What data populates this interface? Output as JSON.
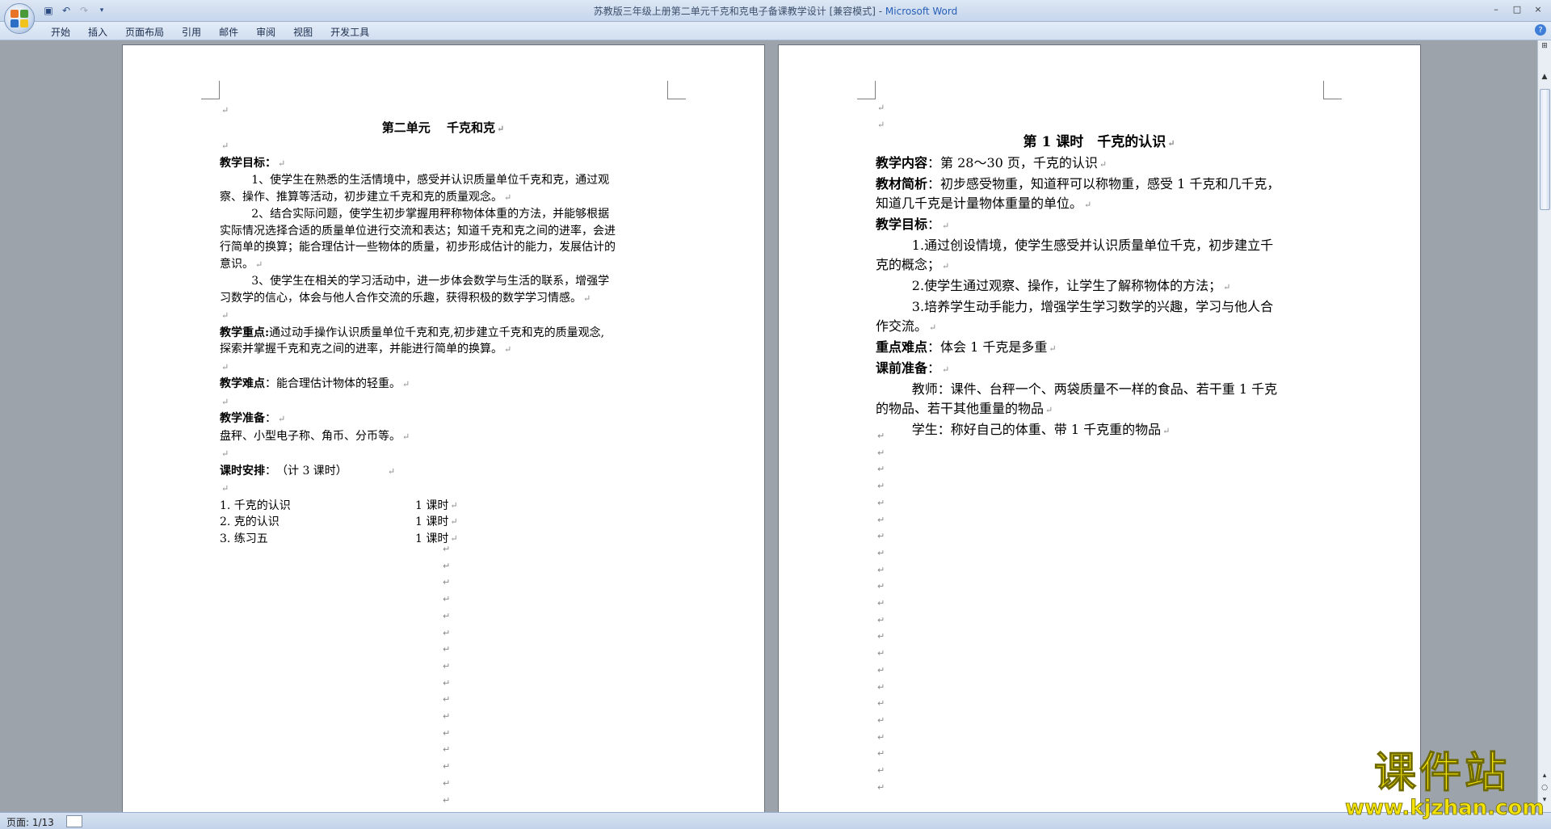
{
  "window": {
    "title_doc": "苏教版三年级上册第二单元千克和克电子备课教学设计 [兼容模式] - ",
    "title_app": "Microsoft Word",
    "min": "–",
    "max": "□",
    "close": "×"
  },
  "ribbon": {
    "tabs": [
      "开始",
      "插入",
      "页面布局",
      "引用",
      "邮件",
      "审阅",
      "视图",
      "开发工具"
    ],
    "help": "?"
  },
  "page1": {
    "title": "第二单元　 千克和克",
    "goals_heading": "教学目标：",
    "goal1_a": "1、使学生在熟悉的生活情境中，感受并认识质量单位千克和克，通过观",
    "goal1_b": "察、操作、推算等活动，初步建立千克和克的质量观念。",
    "goal2_a": "2、结合实际问题，使学生初步掌握用秤称物体体重的方法，并能够根据",
    "goal2_b": "实际情况选择合适的质量单位进行交流和表达；知道千克和克之间的进率，会进",
    "goal2_c": "行简单的换算；能合理估计一些物体的质量，初步形成估计的能力，发展估计的",
    "goal2_d": "意识。",
    "goal3_a": "3、使学生在相关的学习活动中，进一步体会数学与生活的联系，增强学",
    "goal3_b": "习数学的信心，体会与他人合作交流的乐趣，获得积极的数学学习情感。",
    "key_label": "教学重点:",
    "key_a": "通过动手操作认识质量单位千克和克,初步建立千克和克的质量观念,",
    "key_b": "探索并掌握千克和克之间的进率，并能进行简单的换算。",
    "diff_label": "教学难点",
    "diff_text": "：能合理估计物体的轻重。",
    "prep_label": "教学准备",
    "prep_colon": "：",
    "prep_text": "盘秤、小型电子称、角币、分币等。",
    "sched_label": "课时安排",
    "sched_text": "：　（计 3 课时）",
    "plan": [
      {
        "name": "1. 千克的认识",
        "hours": "1 课时"
      },
      {
        "name": "2. 克的认识",
        "hours": "1 课时"
      },
      {
        "name": "3. 练习五",
        "hours": "1 课时"
      }
    ]
  },
  "page2": {
    "title": "第 1 课时　千克的认识",
    "content_label": "教学内容",
    "content_text": "：第 28～30 页，千克的认识",
    "analysis_label": "教材简析",
    "analysis_a": "：初步感受物重，知道秤可以称物重，感受 1 千克和几千克，",
    "analysis_b": "知道几千克是计量物体重量的单位。",
    "goals_heading": "教学目标",
    "goals_colon": "：",
    "goal1_a": "1.通过创设情境，使学生感受并认识质量单位千克，初步建立千",
    "goal1_b": "克的概念；",
    "goal2": "2.使学生通过观察、操作，让学生了解称物体的方法；",
    "goal3_a": "3.培养学生动手能力，增强学生学习数学的兴趣，学习与他人合",
    "goal3_b": "作交流。",
    "focus_label": "重点难点",
    "focus_text": "：体会 1 千克是多重",
    "prep_label": "课前准备",
    "prep_colon": "：",
    "teacher_a": "教师：课件、台秤一个、两袋质量不一样的食品、若干重 1 千克",
    "teacher_b": "的物品、若干其他重量的物品",
    "student": "学生：称好自己的体重、带 1 千克重的物品"
  },
  "status": {
    "page": "页面: 1/13"
  },
  "watermark": {
    "name": "课件站",
    "url": "www.kjzhan.com"
  }
}
